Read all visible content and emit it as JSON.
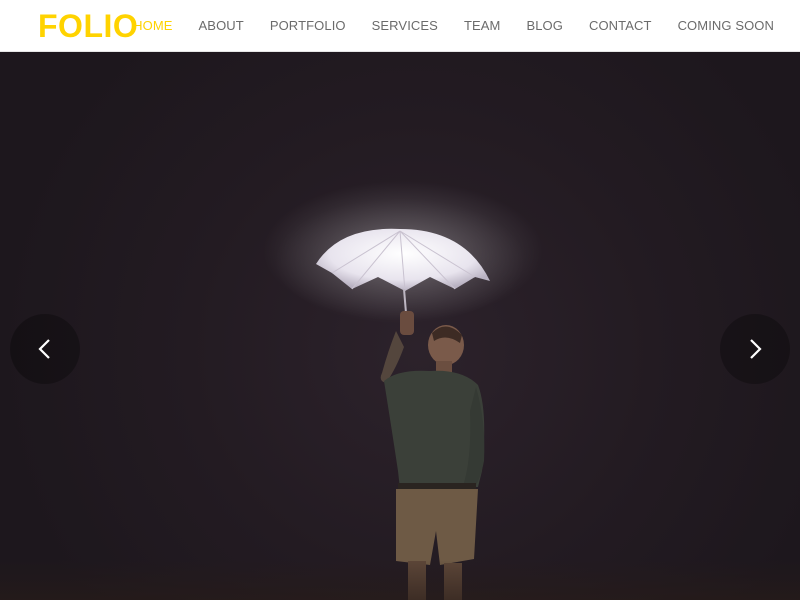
{
  "brand": {
    "logo_text": "FOLIO",
    "accent_color": "#ffd300"
  },
  "nav": {
    "items": [
      {
        "label": "HOME",
        "active": true
      },
      {
        "label": "ABOUT",
        "active": false
      },
      {
        "label": "PORTFOLIO",
        "active": false
      },
      {
        "label": "SERVICES",
        "active": false
      },
      {
        "label": "TEAM",
        "active": false
      },
      {
        "label": "BLOG",
        "active": false
      },
      {
        "label": "CONTACT",
        "active": false
      },
      {
        "label": "COMING SOON",
        "active": false
      }
    ]
  },
  "hero": {
    "image_subject": "man holding glowing white umbrella at night",
    "prev_icon": "chevron-left-icon",
    "next_icon": "chevron-right-icon"
  }
}
